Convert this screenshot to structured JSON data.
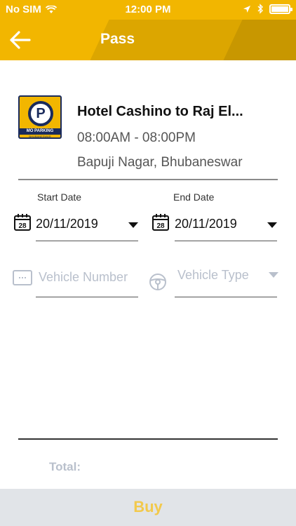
{
  "status_bar": {
    "carrier": "No SIM",
    "time": "12:00 PM"
  },
  "header": {
    "title": "Pass"
  },
  "parking": {
    "logo_letter": "P",
    "logo_brand": "MO PARKING",
    "logo_city": "BHUBANESWAR",
    "name": "Hotel Cashino to Raj El...",
    "hours": "08:00AM - 08:00PM",
    "location": "Bapuji Nagar, Bhubaneswar"
  },
  "form": {
    "start_date_label": "Start Date",
    "start_date_value": "20/11/2019",
    "end_date_label": "End Date",
    "end_date_value": "20/11/2019",
    "calendar_day": "28",
    "vehicle_number_placeholder": "Vehicle Number",
    "vehicle_type_placeholder": "Vehicle Type"
  },
  "footer": {
    "total_label": "Total:",
    "buy_label": "Buy"
  },
  "colors": {
    "brand": "#f2b600",
    "brand_dark": "#1a2b5c",
    "placeholder": "#b9c0cc",
    "buy_bar": "#e1e4e8"
  }
}
